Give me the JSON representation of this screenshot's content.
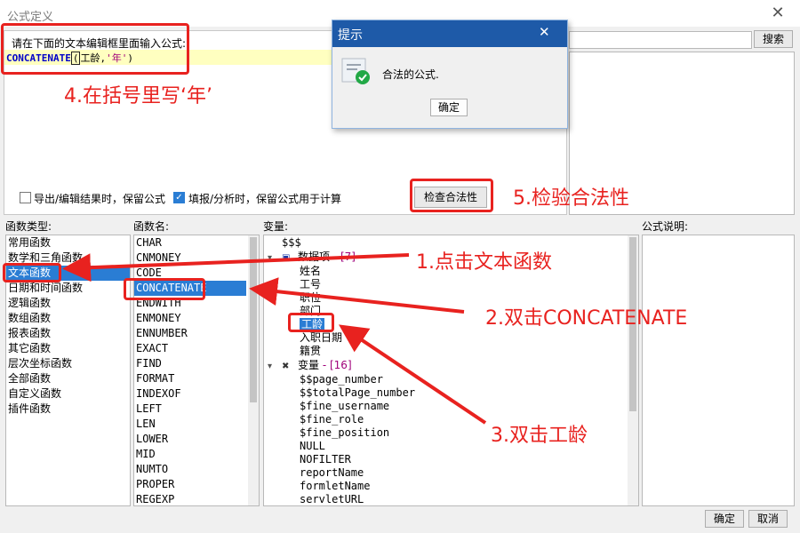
{
  "window": {
    "title": "公式定义",
    "close_glyph": "✕"
  },
  "editor": {
    "prompt": "请在下面的文本编辑框里面输入公式:",
    "formula_fn": "CONCATENATE",
    "formula_paren": "(",
    "formula_arg": "工龄,",
    "formula_str": "'年'",
    "formula_close": ")"
  },
  "search": {
    "button": "搜索",
    "value": ""
  },
  "options": {
    "export_keep_formula": {
      "label": "导出/编辑结果时，保留公式",
      "checked": false
    },
    "fill_keep_formula": {
      "label": "填报/分析时，保留公式用于计算",
      "checked": true
    }
  },
  "check_button": "检查合法性",
  "labels": {
    "func_type": "函数类型:",
    "func_name": "函数名:",
    "variable": "变量:",
    "formula_desc": "公式说明:"
  },
  "func_types": [
    "常用函数",
    "数学和三角函数",
    "文本函数",
    "日期和时间函数",
    "逻辑函数",
    "数组函数",
    "报表函数",
    "其它函数",
    "层次坐标函数",
    "全部函数",
    "自定义函数",
    "插件函数"
  ],
  "func_type_selected": 2,
  "func_names": [
    "CHAR",
    "CNMONEY",
    "CODE",
    "CONCATENATE",
    "ENDWITH",
    "ENMONEY",
    "ENNUMBER",
    "EXACT",
    "FIND",
    "FORMAT",
    "INDEXOF",
    "LEFT",
    "LEN",
    "LOWER",
    "MID",
    "NUMTO",
    "PROPER",
    "REGEXP"
  ],
  "func_name_selected": 3,
  "variables": {
    "root": "$$$",
    "dataset_label": "数据项",
    "dataset_count": "- [7]",
    "dataset_items": [
      "姓名",
      "工号",
      "职位",
      "部门",
      "工龄",
      "入职日期",
      "籍贯"
    ],
    "dataset_selected": 4,
    "var_label": "变量",
    "var_count": "- [16]",
    "var_items": [
      "$$page_number",
      "$$totalPage_number",
      "$fine_username",
      "$fine_role",
      "$fine_position",
      "NULL",
      "NOFILTER",
      "reportName",
      "formletName",
      "servletURL"
    ]
  },
  "dialog": {
    "title": "提示",
    "message": "合法的公式.",
    "ok": "确定",
    "close_glyph": "✕"
  },
  "footer": {
    "ok": "确定",
    "cancel": "取消"
  },
  "annotations": {
    "step1": "1.点击文本函数",
    "step2": "2.双击CONCATENATE",
    "step3": "3.双击工龄",
    "step4": "4.在括号里写‘年’",
    "step5": "5.检验合法性"
  },
  "colors": {
    "accent": "#2a7dd4",
    "annotation": "#e8221f",
    "dialog_title": "#1e5aa8",
    "editor_highlight": "#ffffc0"
  }
}
